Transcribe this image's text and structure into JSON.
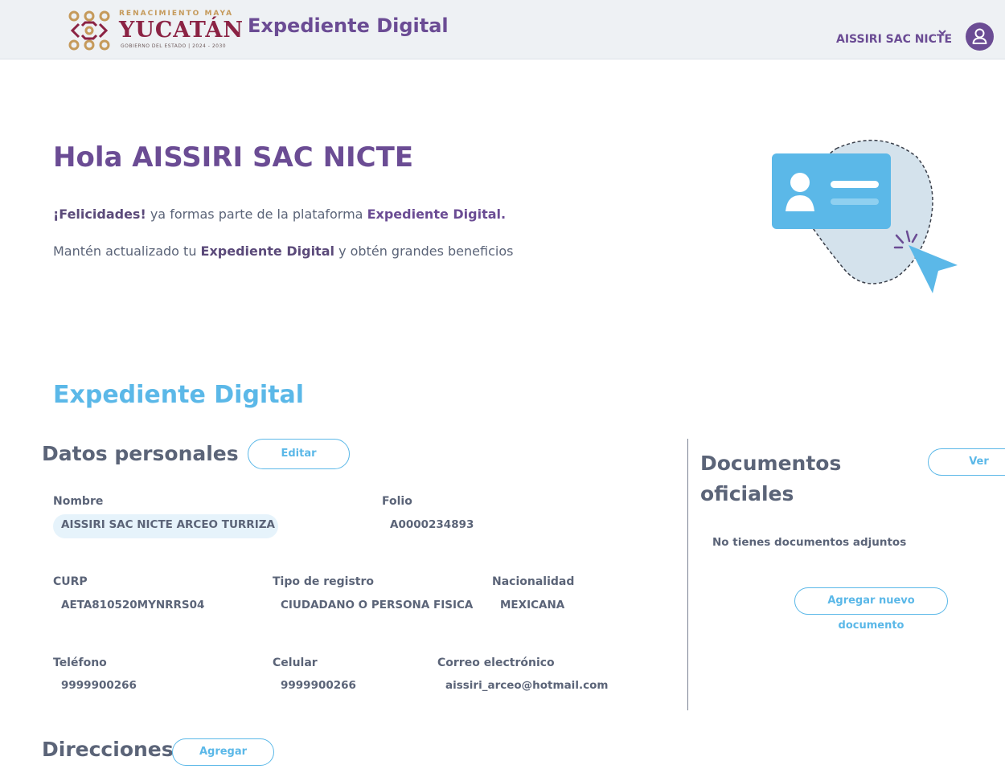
{
  "header": {
    "logo_top": "RENACIMIENTO MAYA",
    "logo_main": "YUCATÁN",
    "logo_sub": "GOBIERNO DEL ESTADO | 2024 - 2030",
    "app_title": "Expediente Digital",
    "user_name": "AISSIRI SAC NICTE",
    "chevron_icon": "chevron-down-icon",
    "avatar_icon": "user-icon"
  },
  "welcome": {
    "greeting": "Hola AISSIRI SAC NICTE",
    "line1_prefix": "¡Felicidades!",
    "line1_mid": " ya formas parte de la plataforma ",
    "line1_bold": "Expediente Digital.",
    "line2_prefix": "Mantén actualizado tu ",
    "line2_bold": "Expediente Digital",
    "line2_suffix": " y obtén grandes beneficios"
  },
  "section_title": "Expediente Digital",
  "personal": {
    "title": "Datos personales",
    "edit_label": "Editar",
    "nombre_label": "Nombre",
    "nombre_value": "AISSIRI SAC NICTE ARCEO TURRIZA",
    "folio_label": "Folio",
    "folio_value": "A0000234893",
    "curp_label": "CURP",
    "curp_value": "AETA810520MYNRRS04",
    "tipo_label": "Tipo de registro",
    "tipo_value": "CIUDADANO O PERSONA FISICA",
    "nacionalidad_label": "Nacionalidad",
    "nacionalidad_value": "MEXICANA",
    "telefono_label": "Teléfono",
    "telefono_value": "9999900266",
    "celular_label": "Celular",
    "celular_value": "9999900266",
    "correo_label": "Correo electrónico",
    "correo_value": "aissiri_arceo@hotmail.com"
  },
  "documents": {
    "title_line1": "Documentos",
    "title_line2": "oficiales",
    "view_label": "Ver",
    "empty_text": "No tienes documentos adjuntos",
    "add_label": "Agregar nuevo documento"
  },
  "addresses": {
    "title": "Direcciones",
    "add_label": "Agregar"
  },
  "colors": {
    "purple": "#6b4c94",
    "blue": "#5bb8e8",
    "maroon": "#8b2344",
    "gold": "#c59a5b",
    "text": "#5b6478"
  }
}
